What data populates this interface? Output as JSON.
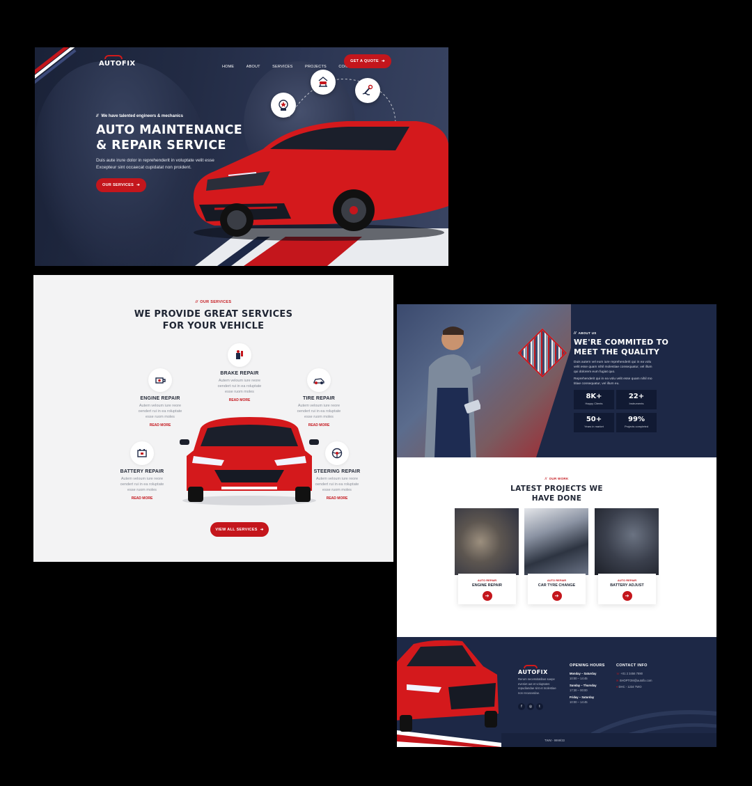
{
  "brand": {
    "name": "AUTOFIX",
    "accent": "#c4161c",
    "navy": "#1d2846"
  },
  "hero": {
    "nav": [
      "HOME",
      "ABOUT",
      "SERVICES",
      "PROJECTS",
      "CONTACT"
    ],
    "quote_button": "GET A QUOTE",
    "tagline": "We have talented engineers & mechanics",
    "title_line1": "AUTO MAINTENANCE",
    "title_line2": "& REPAIR SERVICE",
    "text_line1": "Duis aute irure dolor in reprehenderit in voluptate velit esse",
    "text_line2": "Excepteur sint occaecat cupidatat non proident.",
    "cta": "OUR SERVICES",
    "icons": [
      "tools-badge-icon",
      "car-lift-icon",
      "wrench-hand-icon"
    ]
  },
  "services": {
    "kicker": "OUR SERVICES",
    "title_line1": "WE PROVIDE GREAT SERVICES",
    "title_line2": "FOR YOUR VEHICLE",
    "items": [
      {
        "name": "BRAKE REPAIR",
        "desc1": "Autem veloum iure reore",
        "desc2": "oendert rui in ea roluptate",
        "desc3": "esse ruom moles",
        "more": "READ MORE",
        "icon": "brake-icon"
      },
      {
        "name": "ENGINE REPAIR",
        "desc1": "Autem veloum iure reore",
        "desc2": "oendert rui in ea roluptate",
        "desc3": "esse ruom moles",
        "more": "READ MORE",
        "icon": "engine-icon"
      },
      {
        "name": "TIRE REPAIR",
        "desc1": "Autem veloum iure reore",
        "desc2": "oendert rui in ea roluptate",
        "desc3": "esse ruom moles",
        "more": "READ MORE",
        "icon": "tire-car-icon"
      },
      {
        "name": "BATTERY REPAIR",
        "desc1": "Autem veloum iure reore",
        "desc2": "oendert rui in ea roluptate",
        "desc3": "esse ruom moles",
        "more": "READ MORE",
        "icon": "battery-icon"
      },
      {
        "name": "STEERING REPAIR",
        "desc1": "Autem veloum iure reore",
        "desc2": "oendert rui in ea roluptate",
        "desc3": "esse ruom moles",
        "more": "READ MORE",
        "icon": "steering-wheel-icon"
      }
    ],
    "view_all": "VIEW ALL SERVICES"
  },
  "about": {
    "kicker": "ABOUT US",
    "title_line1": "WE'RE COMMITED TO",
    "title_line2": "MEET THE QUALITY",
    "p1_line1": "Duis autem vel eum iure reprehenderit qui in ea volu",
    "p1_line2": "velit esse quam nihil molestiae consequatur, vel illum",
    "p1_line3": "qui dolorem eum fugiat quo.",
    "p2_line1": "Reprehenderit qui in ea volu velit esse quam nihil mo",
    "p2_line2": "titiae consequatur, vel illum eu.",
    "stats": [
      {
        "value": "8K+",
        "label": "Happy Clients"
      },
      {
        "value": "22+",
        "label": "Instruments"
      },
      {
        "value": "50+",
        "label": "Years in market"
      },
      {
        "value": "99%",
        "label": "Projects completed"
      }
    ]
  },
  "projects": {
    "kicker": "OUR WORK",
    "title_line1": "LATEST PROJECTS WE",
    "title_line2": "HAVE DONE",
    "items": [
      {
        "category": "AUTO REPAIR",
        "title": "ENGINE REPAIR"
      },
      {
        "category": "AUTO REPAIR",
        "title": "CAR TYRE CHANGE"
      },
      {
        "category": "AUTO REPAIR",
        "title": "BATTERY ADJUST"
      }
    ]
  },
  "footer": {
    "brand": "AUTOFIX",
    "about_line1": "Rerum necessitatibus saepe",
    "about_line2": "eveniet aut et voluptates",
    "about_line3": "repudiandae sint et molestiae",
    "about_line4": "non recusandae.",
    "hours_title": "OPENING HOURS",
    "hours": [
      {
        "days": "Monday – Saturday",
        "time": "10:00 – 14:45"
      },
      {
        "days": "Sunday – Thursday",
        "time": "17:30 – 00:00"
      },
      {
        "days": "Friday – Saturday",
        "time": "10:00 – 14:45"
      }
    ],
    "contact_title": "CONTACT INFO",
    "contact": [
      "+01 2 3456 7890",
      "SHOPTOM@autofix.com",
      "DHC - 1234 TWO"
    ],
    "copyright": "TWM - 9999/33"
  }
}
